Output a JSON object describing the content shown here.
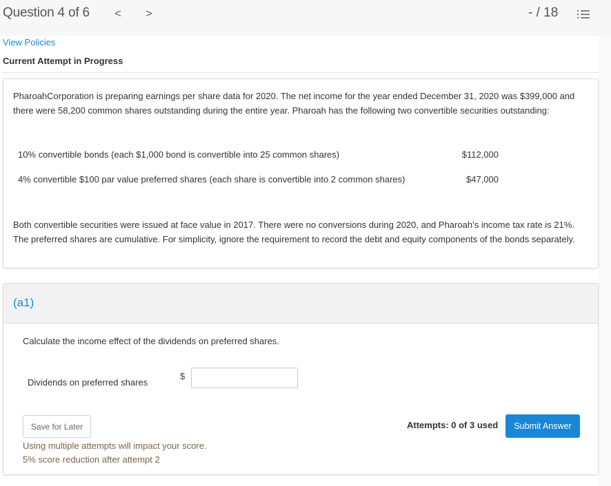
{
  "header": {
    "question_position": "Question 4 of 6",
    "prev_icon": "chevron-left-icon",
    "prev_glyph": "<",
    "next_icon": "chevron-right-icon",
    "next_glyph": ">",
    "score": "- / 18",
    "list_icon": "numbered-list-icon"
  },
  "links": {
    "view_policies": "View Policies"
  },
  "attempt_status": "Current Attempt in Progress",
  "problem": {
    "paragraph1": "PharoahCorporation is preparing earnings per share data for 2020. The net income for the year ended December 31, 2020 was $399,000 and there were 58,200 common shares outstanding during the entire year. Pharoah has the following two convertible securities outstanding:",
    "securities": [
      {
        "description": "10% convertible bonds (each $1,000 bond is convertible into 25 common shares)",
        "amount": "$112,000"
      },
      {
        "description": "4% convertible $100 par value preferred shares (each share is convertible into 2 common shares)",
        "amount": "$47,000"
      }
    ],
    "paragraph2": "Both convertible securities were issued at face value in 2017. There were no conversions during 2020, and Pharoah’s income tax rate is 21%. The preferred shares are cumulative. For simplicity, ignore the requirement to record the debt and equity components of the bonds separately."
  },
  "part": {
    "label": "(a1)",
    "instruction": "Calculate the income effect of the dividends on preferred shares.",
    "field_label": "Dividends on preferred shares",
    "currency_symbol": "$",
    "input_value": "",
    "input_placeholder": ""
  },
  "footer": {
    "save_label": "Save for Later",
    "note_line1": "Using multiple attempts will impact your score.",
    "note_line2": "5% score reduction after attempt 2",
    "attempts_used": "Attempts: 0 of 3 used",
    "submit_label": "Submit Answer"
  },
  "colors": {
    "accent": "#1a86d6",
    "note_text": "#7a6448"
  }
}
